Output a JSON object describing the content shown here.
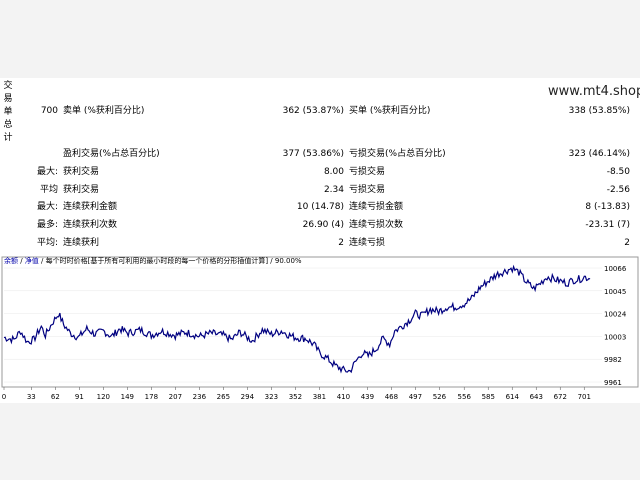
{
  "vertical_label": "交易单总计",
  "watermark": "www.mt4.shop",
  "rows": [
    {
      "id": "r1",
      "c0": "700",
      "c1": "卖单 (%获利百分比)",
      "c2": "362 (53.87%)",
      "c3": "买单 (%获利百分比)",
      "c4": "338 (53.85%)"
    },
    {
      "id": "r2",
      "c0": "",
      "c1": "盈利交易(%占总百分比)",
      "c2": "377 (53.86%)",
      "c3": "亏损交易(%占总百分比)",
      "c4": "323 (46.14%)"
    },
    {
      "id": "r3",
      "c0": "最大:",
      "c1": "获利交易",
      "c2": "8.00",
      "c3": "亏损交易",
      "c4": "-8.50"
    },
    {
      "id": "r4",
      "c0": "平均",
      "c1": "获利交易",
      "c2": "2.34",
      "c3": "亏损交易",
      "c4": "-2.56"
    },
    {
      "id": "r5",
      "c0": "最大:",
      "c1": "连续获利金额",
      "c2": "10 (14.78)",
      "c3": "连续亏损金额",
      "c4": "8 (-13.83)"
    },
    {
      "id": "r6",
      "c0": "最多:",
      "c1": "连续获利次数",
      "c2": "26.90 (4)",
      "c3": "连续亏损次数",
      "c4": "-23.31 (7)"
    },
    {
      "id": "r7",
      "c0": "平均:",
      "c1": "连续获利",
      "c2": "2",
      "c3": "连续亏损",
      "c4": "2"
    }
  ],
  "legend": {
    "balance": "余额",
    "sep1": " / ",
    "equity": "净值",
    "rest": " / 每个时时价格[基于所有可利用的最小时段的每一个价格的分形插值计算] / 90.00%"
  },
  "chart_data": {
    "type": "line",
    "x_ticks": [
      "0",
      "33",
      "62",
      "91",
      "120",
      "149",
      "178",
      "207",
      "236",
      "265",
      "294",
      "323",
      "352",
      "381",
      "410",
      "439",
      "468",
      "497",
      "526",
      "556",
      "585",
      "614",
      "643",
      "672",
      "701"
    ],
    "y_ticks": [
      "10066",
      "10045",
      "10024",
      "10003",
      "9982",
      "9961"
    ],
    "ylim": [
      9961,
      10066
    ],
    "xlim": [
      0,
      720
    ],
    "line_color": "#000080",
    "series": [
      {
        "values": [
          [
            0,
            10002
          ],
          [
            12,
            10000
          ],
          [
            20,
            10008
          ],
          [
            28,
            9998
          ],
          [
            36,
            10000
          ],
          [
            45,
            10012
          ],
          [
            50,
            10004
          ],
          [
            58,
            10015
          ],
          [
            66,
            10024
          ],
          [
            72,
            10014
          ],
          [
            80,
            10006
          ],
          [
            90,
            10002
          ],
          [
            100,
            10010
          ],
          [
            110,
            10005
          ],
          [
            120,
            10008
          ],
          [
            130,
            10003
          ],
          [
            140,
            10010
          ],
          [
            150,
            10006
          ],
          [
            165,
            10009
          ],
          [
            178,
            10004
          ],
          [
            190,
            10008
          ],
          [
            207,
            10004
          ],
          [
            220,
            10007
          ],
          [
            236,
            10003
          ],
          [
            250,
            10006
          ],
          [
            265,
            10004
          ],
          [
            275,
            10000
          ],
          [
            285,
            10007
          ],
          [
            294,
            10002
          ],
          [
            300,
            9999
          ],
          [
            312,
            10009
          ],
          [
            323,
            10005
          ],
          [
            335,
            10008
          ],
          [
            345,
            10004
          ],
          [
            352,
            10002
          ],
          [
            365,
            10001
          ],
          [
            375,
            9995
          ],
          [
            381,
            9988
          ],
          [
            390,
            9983
          ],
          [
            400,
            9976
          ],
          [
            410,
            9972
          ],
          [
            418,
            9971
          ],
          [
            425,
            9980
          ],
          [
            433,
            9988
          ],
          [
            440,
            9985
          ],
          [
            450,
            9992
          ],
          [
            458,
            10001
          ],
          [
            466,
            9996
          ],
          [
            472,
            10008
          ],
          [
            480,
            10012
          ],
          [
            490,
            10018
          ],
          [
            497,
            10024
          ],
          [
            505,
            10022
          ],
          [
            515,
            10028
          ],
          [
            525,
            10026
          ],
          [
            535,
            10030
          ],
          [
            545,
            10030
          ],
          [
            556,
            10033
          ],
          [
            565,
            10038
          ],
          [
            575,
            10048
          ],
          [
            585,
            10054
          ],
          [
            595,
            10060
          ],
          [
            605,
            10063
          ],
          [
            614,
            10066
          ],
          [
            622,
            10062
          ],
          [
            630,
            10054
          ],
          [
            640,
            10047
          ],
          [
            648,
            10052
          ],
          [
            656,
            10058
          ],
          [
            664,
            10056
          ],
          [
            672,
            10054
          ],
          [
            680,
            10052
          ],
          [
            688,
            10055
          ],
          [
            696,
            10056
          ],
          [
            701,
            10058
          ],
          [
            708,
            10056
          ]
        ]
      }
    ]
  }
}
